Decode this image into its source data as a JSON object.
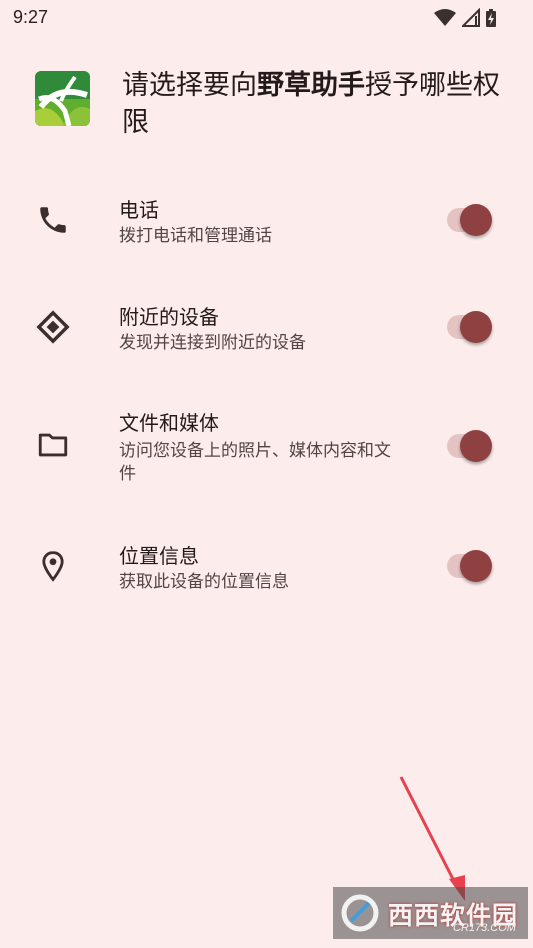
{
  "status_bar": {
    "time": "9:27",
    "icons": [
      "wifi-icon",
      "signal-icon",
      "battery-icon"
    ]
  },
  "header": {
    "title_prefix": "请选择要向",
    "app_name": "野草助手",
    "title_suffix": "授予哪些权限",
    "logo_icon": "app-logo-icon"
  },
  "permissions": [
    {
      "icon": "phone-icon",
      "title": "电话",
      "description": "拨打电话和管理通话",
      "enabled": true
    },
    {
      "icon": "nearby-devices-icon",
      "title": "附近的设备",
      "description": "发现并连接到附近的设备",
      "enabled": true
    },
    {
      "icon": "folder-icon",
      "title": "文件和媒体",
      "description": "访问您设备上的照片、媒体内容和文件",
      "enabled": true
    },
    {
      "icon": "location-icon",
      "title": "位置信息",
      "description": "获取此设备的位置信息",
      "enabled": true
    }
  ],
  "colors": {
    "background": "#fcecec",
    "toggle_thumb": "#8f4141",
    "toggle_track": "#e6c3c3",
    "accent_arrow": "#e8414d"
  },
  "watermark": {
    "text": "西西软件园",
    "sub": "CR173.COM"
  }
}
